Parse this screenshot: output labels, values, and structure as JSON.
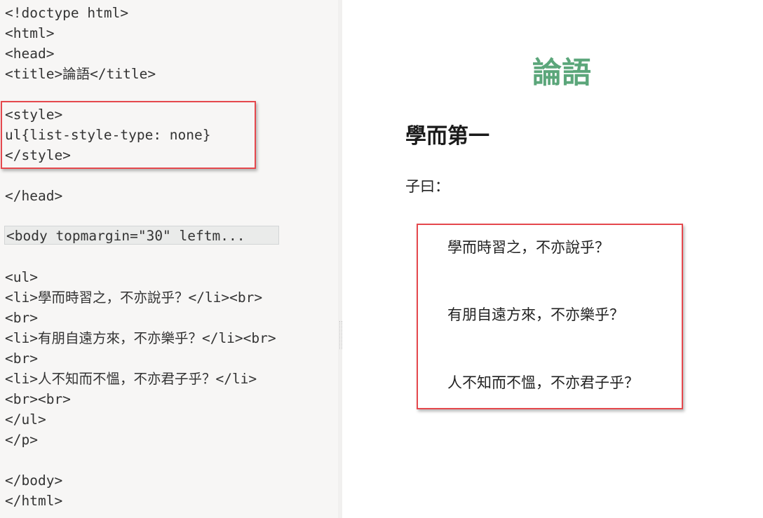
{
  "editor": {
    "lines": [
      "<!doctype html>",
      "<html>",
      "<head>",
      "<title>論語</title>",
      "",
      "<style>",
      "ul{list-style-type: none}",
      "</style>",
      "",
      "</head>",
      "",
      "<ul>",
      "<li>學而時習之，不亦說乎？</li><br>",
      "<br>",
      "<li>有朋自遠方來，不亦樂乎？</li><br>",
      "<br>",
      "<li>人不知而不慍，不亦君子乎？</li>",
      "<br><br>",
      "</ul>",
      "</p>",
      "",
      "</body>",
      "</html>"
    ],
    "folded_body": "<body topmargin=\"30\" leftm..."
  },
  "preview": {
    "title": "論語",
    "heading": "學而第一",
    "intro": "子曰：",
    "items": [
      "學而時習之，不亦說乎？",
      "有朋自遠方來，不亦樂乎？",
      "人不知而不慍，不亦君子乎？"
    ]
  },
  "colors": {
    "title_green": "#5ba67a",
    "highlight_red": "#e5484d",
    "editor_bg": "#f7f6f5"
  }
}
